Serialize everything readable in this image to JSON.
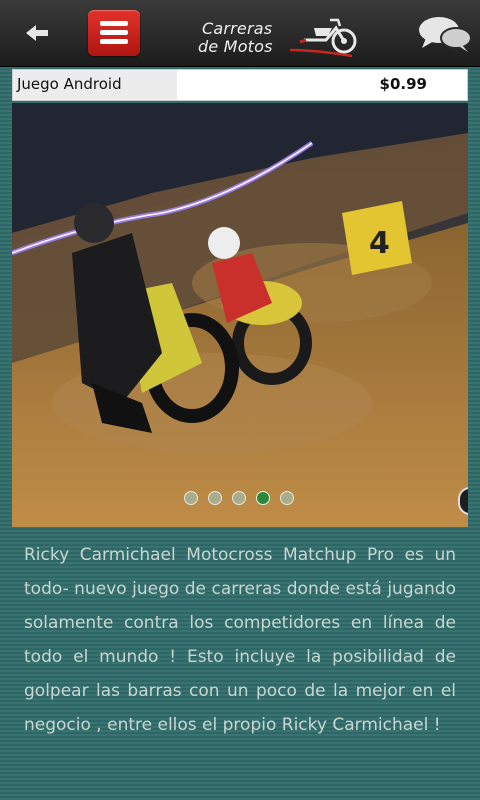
{
  "header": {
    "back_icon": "arrow-left-icon",
    "menu_icon": "hamburger-menu-icon",
    "logo": {
      "line1": "Carreras",
      "line2": "de Motos"
    },
    "chat_icon": "speech-bubbles-icon",
    "colors": {
      "menu_button": "#d5231f",
      "bar": "#2a2a2a"
    }
  },
  "product": {
    "label": "Juego Android",
    "price": "$0.99"
  },
  "gallery": {
    "slide_count": 5,
    "active_index": 3,
    "overlay_badge": "4",
    "colors": {
      "active_dot": "#2a8a3a",
      "inactive_dot": "#a9ad8d"
    }
  },
  "description": "Ricky Carmichael Motocross Matchup Pro es un todo- nuevo juego de carreras donde está jugando solamente contra los competidores en línea de todo el mundo ! Esto incluye la posibilidad de golpear las barras con un poco de la mejor en el negocio , entre ellos el propio Ricky Carmichael !"
}
